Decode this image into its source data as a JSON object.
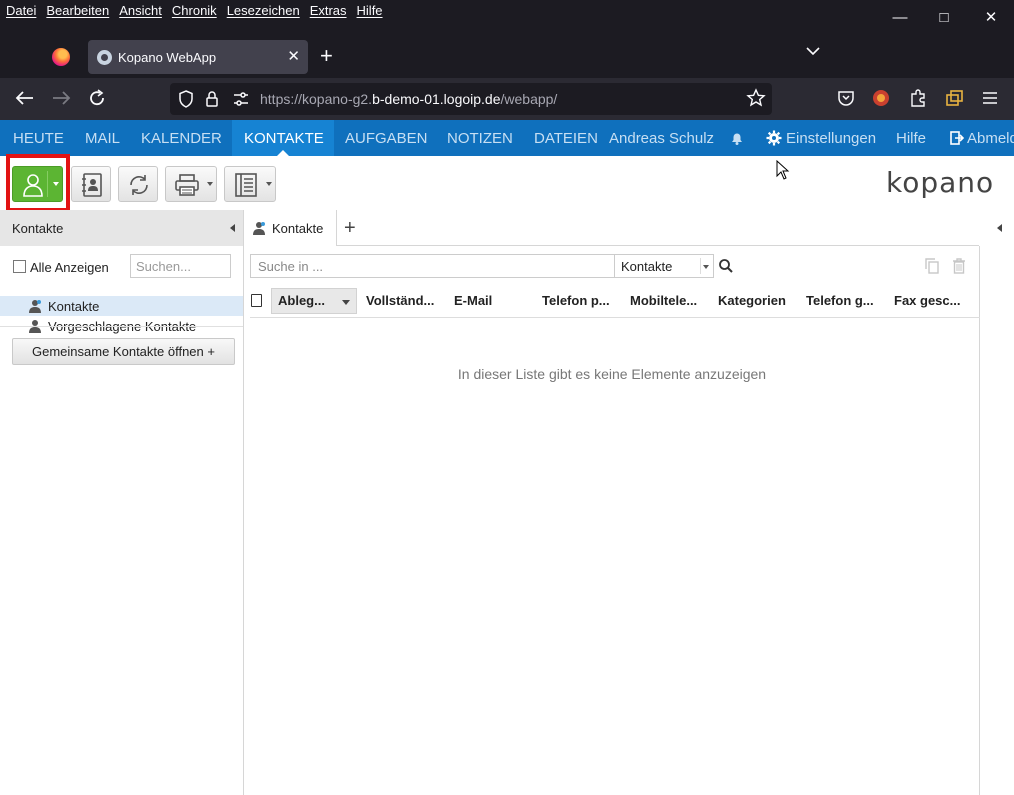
{
  "menubar": {
    "items": [
      "Datei",
      "Bearbeiten",
      "Ansicht",
      "Chronik",
      "Lesezeichen",
      "Extras",
      "Hilfe"
    ]
  },
  "window_controls": {
    "minimize": "—",
    "maximize": "□",
    "close": "✕"
  },
  "tab": {
    "title": "Kopano WebApp",
    "close": "✕",
    "new": "+",
    "list": "⌄"
  },
  "address": {
    "prefix": "https://kopano-g2.",
    "host": "b-demo-01.logoip.de",
    "suffix": "/webapp/"
  },
  "app": {
    "nav": {
      "items": [
        "HEUTE",
        "MAIL",
        "KALENDER",
        "KONTAKTE",
        "AUFGABEN",
        "NOTIZEN",
        "DATEIEN"
      ],
      "active": "KONTAKTE",
      "user": "Andreas Schulz",
      "settings": "Einstellungen",
      "help": "Hilfe",
      "logout": "Abmelden"
    },
    "logo": "kopano",
    "left": {
      "title": "Kontakte",
      "show_all": "Alle Anzeigen",
      "search_placeholder": "Suchen...",
      "folders": [
        "Kontakte",
        "Vorgeschlagene Kontakte"
      ],
      "shared_button": "Gemeinsame Kontakte öffnen +"
    },
    "main": {
      "tab_label": "Kontakte",
      "add_tab": "+",
      "search_placeholder": "Suche in ...",
      "search_scope": "Kontakte",
      "columns": [
        "Ableg...",
        "Vollständ...",
        "E-Mail",
        "Telefon p...",
        "Mobiltele...",
        "Kategorien",
        "Telefon g...",
        "Fax gesc..."
      ],
      "empty_text": "In dieser Liste gibt es keine Elemente anzuzeigen"
    }
  }
}
